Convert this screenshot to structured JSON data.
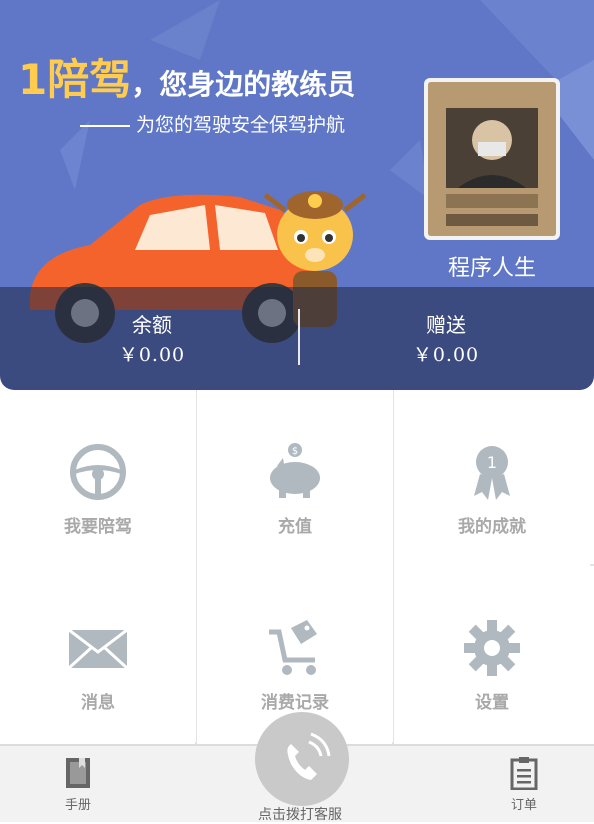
{
  "header": {
    "brand": "1陪驾",
    "headline": "，您身边的教练员",
    "tagline": "为您的驾驶安全保驾护航"
  },
  "profile": {
    "nickname": "程序人生"
  },
  "balance": {
    "left_label": "余额",
    "left_value": "￥0.00",
    "right_label": "赠送",
    "right_value": "￥0.00"
  },
  "grid": [
    {
      "label": "我要陪驾",
      "icon": "steering-wheel-icon"
    },
    {
      "label": "充值",
      "icon": "piggy-bank-icon"
    },
    {
      "label": "我的成就",
      "icon": "award-ribbon-icon"
    },
    {
      "label": "消息",
      "icon": "envelope-icon"
    },
    {
      "label": "消费记录",
      "icon": "shopping-cart-icon"
    },
    {
      "label": "设置",
      "icon": "gear-icon"
    }
  ],
  "bottom_nav": {
    "left_label": "手册",
    "center_label": "点击拨打客服",
    "right_label": "订单"
  },
  "colors": {
    "banner": "#5f77c6",
    "accent": "#ffcc4d",
    "icon_gray": "#b0b8c0",
    "label_gray": "#a9a9a9"
  }
}
